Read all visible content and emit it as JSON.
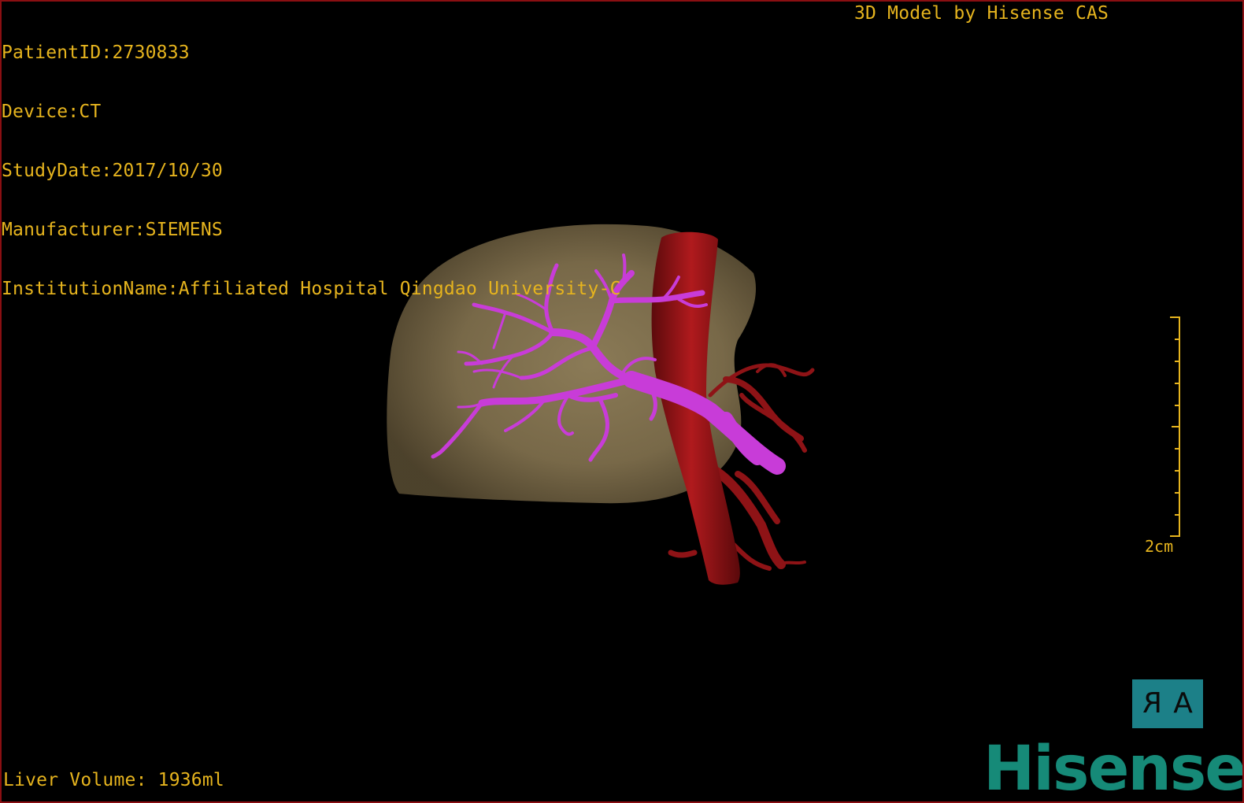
{
  "patient_info": {
    "patient_id": "PatientID:2730833",
    "device": "Device:CT",
    "study_date": "StudyDate:2017/10/30",
    "manufacturer": "Manufacturer:SIEMENS",
    "institution": "InstitutionName:Affiliated Hospital Qingdao University-C"
  },
  "brand_line": "3D Model by Hisense CAS",
  "footer": {
    "liver_volume": "Liver Volume: 1936ml"
  },
  "scale_bar": {
    "label": "2cm"
  },
  "orientation_cube": {
    "left_glyph": "R",
    "right_glyph": "A"
  },
  "logo": {
    "text": "Hisense"
  },
  "colors": {
    "overlay_text": "#e6b41e",
    "border": "#8a0f12",
    "liver": "#8c7a55",
    "portal_vein": "#c83cd8",
    "vessel_red": "#8e1316",
    "cube_bg": "#1c8088",
    "logo": "#168a78"
  }
}
